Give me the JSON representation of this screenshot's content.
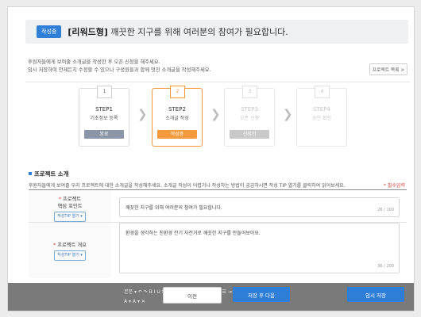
{
  "header": {
    "status_badge": "작성중",
    "title_prefix": "[리워드형]",
    "title_text": " 깨끗한 지구를 위해 여러분의 참여가 필요합니다."
  },
  "guide": {
    "line1": "후원자들에게 보여줄 소개글을 작성한 후 오픈 신청을 해주세요.",
    "line2": "임시 저장하여 언제든지 수정할 수 있으나 구성원들과 함께 멋진 소개글을 작성해주세요.",
    "catalog_button": "프로젝트 목록 >"
  },
  "steps": [
    {
      "num": "1",
      "title": "STEP1",
      "desc": "기초정보 등록",
      "status": "완료",
      "status_color": "#8a95a5",
      "state": "done"
    },
    {
      "num": "2",
      "title": "STEP2",
      "desc": "소개글 작성",
      "status": "작성중",
      "status_color": "#f29a3c",
      "state": "active"
    },
    {
      "num": "3",
      "title": "STEP3",
      "desc": "오픈 신청",
      "status": "신청전",
      "status_color": "#c9c9c9",
      "state": "pending"
    },
    {
      "num": "4",
      "title": "STEP4",
      "desc": "승인 확인",
      "status": "",
      "status_color": "",
      "state": "pending"
    }
  ],
  "section": {
    "title": "프로젝트 소개",
    "description": "후원자들에게 보여줄 우리 프로젝트에 대한 소개글을 작성해주세요. 소개글 작성이 어렵거나 작성하는 방법이 궁금하시면 작성 TIP 열기를 클릭하여 읽어보세요.",
    "required_note": "* 필수입력"
  },
  "fields": [
    {
      "label_line1": "프로젝트",
      "label_line2": "핵심 포인트",
      "tip_button": "작성TIP 열기 ▾",
      "value": "깨끗한 지구를 위해 여러분의 참여가 필요합니다.",
      "counter": "26 / 100"
    },
    {
      "label_line1": "프로젝트 개요",
      "label_line2": "",
      "tip_button": "작성TIP 열기 ▾",
      "value": "환경을 생각하는 친환경 전기 자전거로 깨끗한 지구를 만들어보아요.",
      "counter": "36 / 200"
    }
  ],
  "editor_toolbar": {
    "row1": "본문  ▾  ↶  ↷  B  I  U  S  ABC  x²  x₂  ≡  ≡  ≡  ≡  ❝  ☰  ☰  ⇥  ⇤  ≣  ≣  🔗  ▦  ▤  ☺",
    "row2": "A ▾   A ▾   ✕"
  },
  "buttons": {
    "prev": "이전",
    "save_next": "저장 후 다음",
    "temp_save": "임시 저장"
  }
}
